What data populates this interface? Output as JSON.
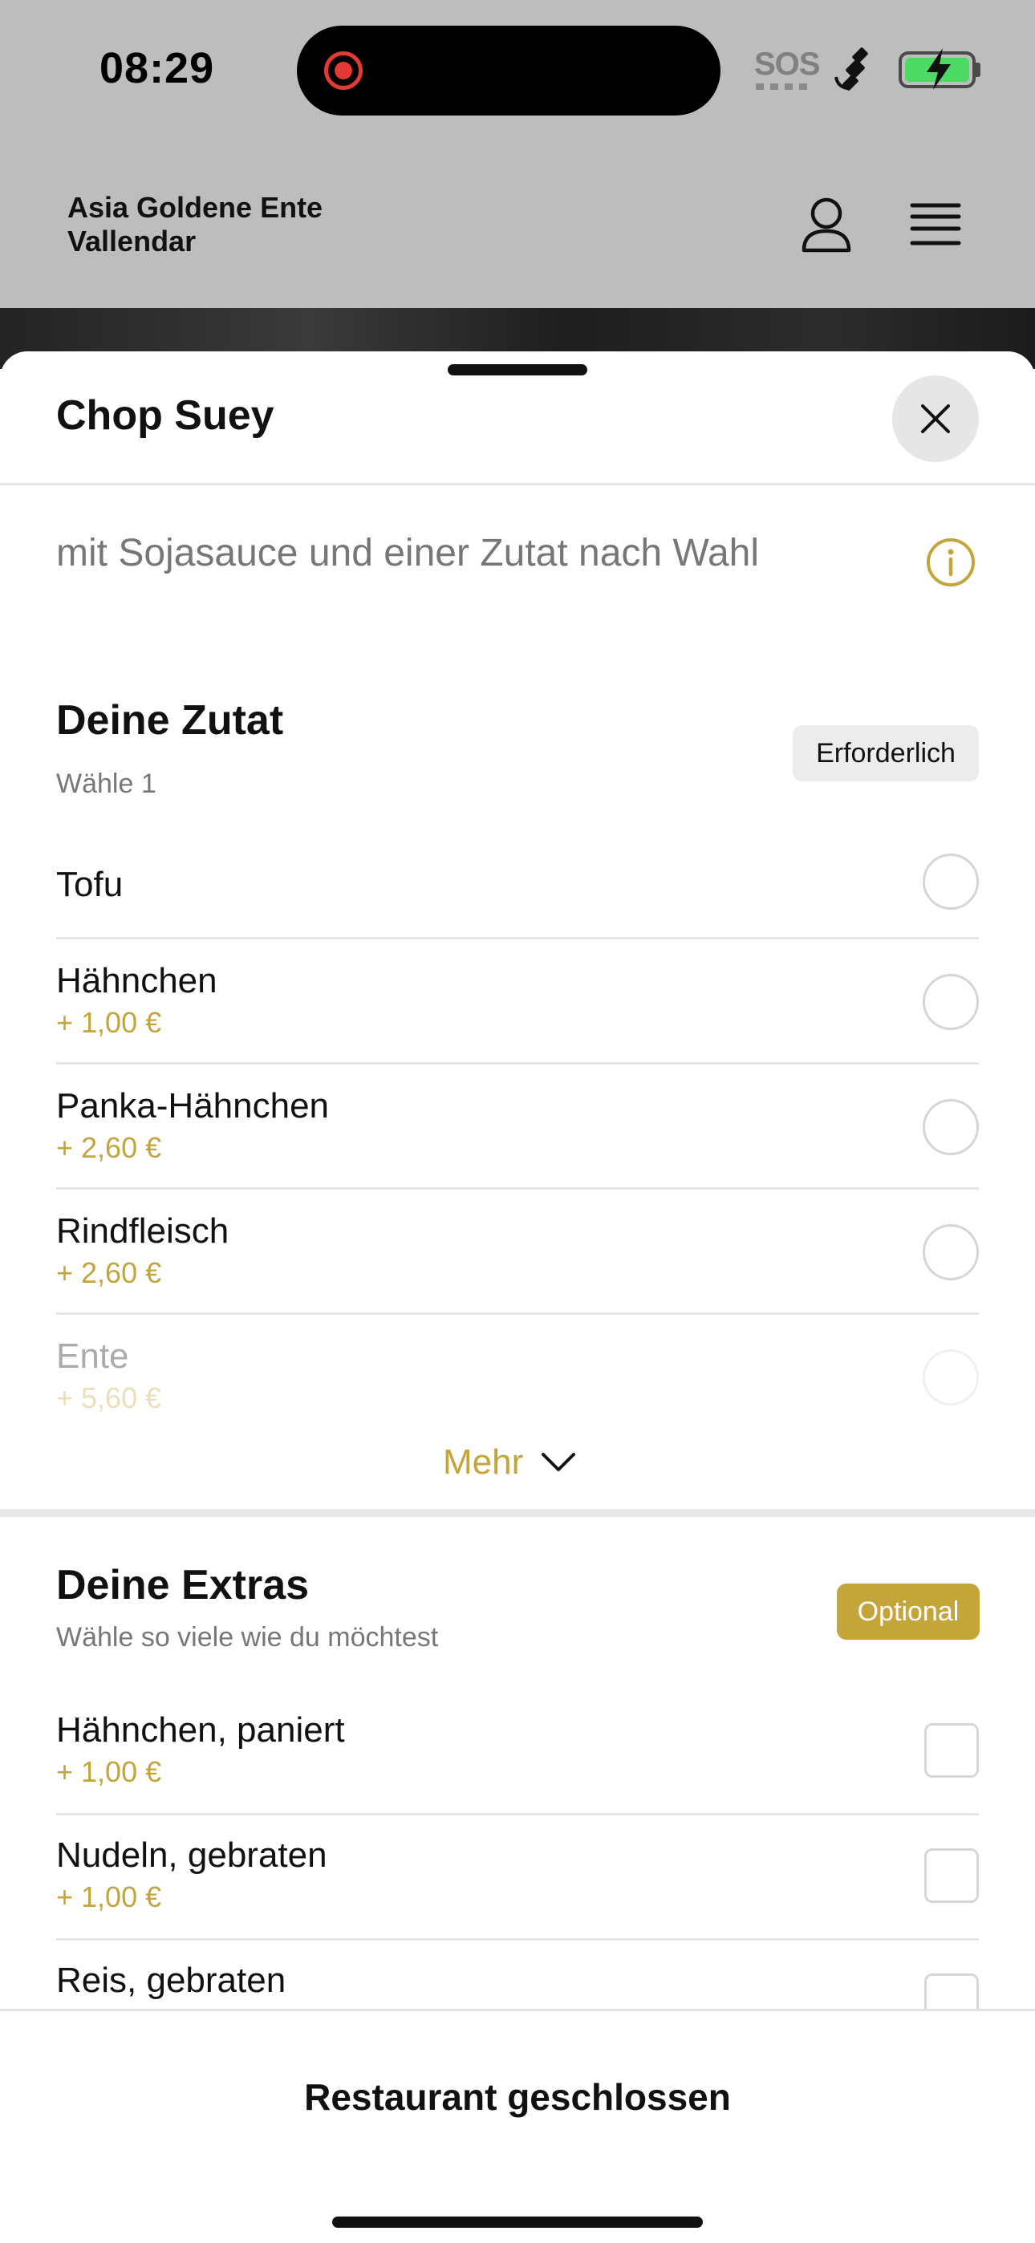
{
  "status_bar": {
    "time": "08:29",
    "sos": "SOS"
  },
  "header": {
    "restaurant_name_line1": "Asia Goldene Ente",
    "restaurant_name_line2": "Vallendar"
  },
  "sheet": {
    "title": "Chop Suey",
    "description": "mit Sojasauce und einer Zutat nach Wahl",
    "ingredient_section": {
      "title": "Deine Zutat",
      "subtitle": "Wähle 1",
      "badge": "Erforderlich",
      "options": [
        {
          "name": "Tofu",
          "price": ""
        },
        {
          "name": "Hähnchen",
          "price": "+ 1,00 €"
        },
        {
          "name": "Panka-Hähnchen",
          "price": "+ 2,60 €"
        },
        {
          "name": "Rindfleisch",
          "price": "+ 2,60 €"
        },
        {
          "name": "Ente",
          "price": "+ 5,60 €"
        }
      ],
      "more_label": "Mehr"
    },
    "extras_section": {
      "title": "Deine Extras",
      "subtitle": "Wähle so viele wie du möchtest",
      "badge": "Optional",
      "options": [
        {
          "name": "Hähnchen, paniert",
          "price": "+ 1,00 €"
        },
        {
          "name": "Nudeln, gebraten",
          "price": "+ 1,00 €"
        },
        {
          "name": "Reis, gebraten",
          "price": ""
        }
      ]
    }
  },
  "footer": {
    "status_text": "Restaurant geschlossen"
  },
  "colors": {
    "accent": "#c4a53a",
    "overlay": "#bdbdbd",
    "record": "#e53935",
    "battery": "#4cd964"
  },
  "icons": [
    "user-icon",
    "menu-icon",
    "close-icon",
    "info-icon",
    "chevron-down-icon",
    "satellite-icon",
    "battery-icon",
    "record-icon"
  ]
}
